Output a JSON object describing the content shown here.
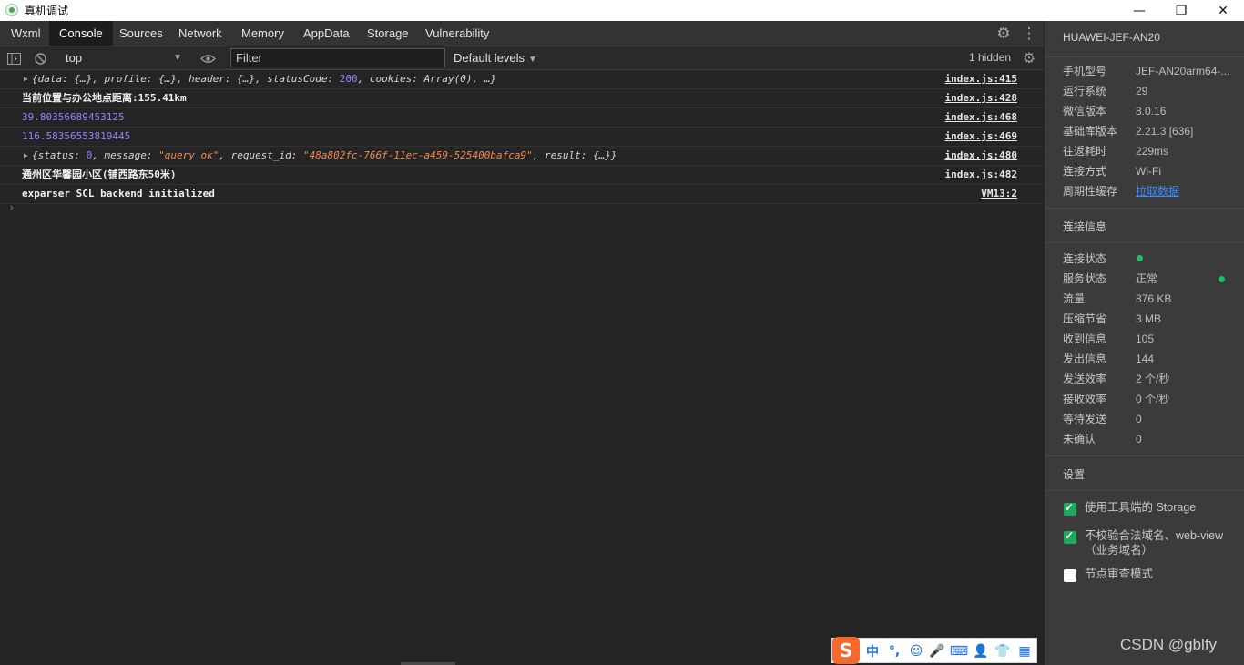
{
  "window": {
    "title": "真机调试",
    "minimize": "—",
    "restore": "❐",
    "close": "✕"
  },
  "tabs": [
    {
      "label": "Wxml"
    },
    {
      "label": "Console"
    },
    {
      "label": "Sources"
    },
    {
      "label": "Network"
    },
    {
      "label": "Memory"
    },
    {
      "label": "AppData"
    },
    {
      "label": "Storage"
    },
    {
      "label": "Vulnerability"
    }
  ],
  "active_tab": "Console",
  "toolbar": {
    "context": "top",
    "filter_placeholder": "Filter",
    "levels": "Default levels",
    "hidden": "1 hidden"
  },
  "console": {
    "rows": [
      {
        "parts": [
          "{data: {…}, profile: {…}, header: {…}, statusCode: ",
          "200",
          ", cookies: Array(0), …}"
        ],
        "source": "index.js:415"
      },
      {
        "text": "当前位置与办公地点距离:155.41km",
        "source": "index.js:428"
      },
      {
        "text": "39.80356689453125",
        "source": "index.js:468"
      },
      {
        "text": "116.58356553819445",
        "source": "index.js:469"
      },
      {
        "parts": [
          "{status: ",
          "0",
          ", message: ",
          "\"query ok\"",
          ", request_id: ",
          "\"48a802fc-766f-11ec-a459-525400bafca9\"",
          ", result: {…}}"
        ],
        "source": "index.js:480"
      },
      {
        "text": "通州区华馨园小区(铺西路东50米)",
        "source": "index.js:482"
      },
      {
        "text": "exparser SCL backend initialized",
        "source": "VM13:2"
      }
    ],
    "prompt": "›"
  },
  "panel": {
    "device": "HUAWEI-JEF-AN20",
    "info": [
      {
        "key": "手机型号",
        "value": "JEF-AN20arm64-..."
      },
      {
        "key": "运行系统",
        "value": "29"
      },
      {
        "key": "微信版本",
        "value": "8.0.16"
      },
      {
        "key": "基础库版本",
        "value": "2.21.3 [636]"
      },
      {
        "key": "往返耗时",
        "value": "229ms"
      },
      {
        "key": "连接方式",
        "value": "Wi-Fi"
      },
      {
        "key": "周期性缓存",
        "value": "拉取数据"
      }
    ],
    "connection_title": "连接信息",
    "connection": [
      {
        "key": "连接状态",
        "value": ""
      },
      {
        "key": "服务状态",
        "value": "正常"
      },
      {
        "key": "流量",
        "value": "876 KB"
      },
      {
        "key": "压缩节省",
        "value": "3 MB"
      },
      {
        "key": "收到信息",
        "value": "105"
      },
      {
        "key": "发出信息",
        "value": "144"
      },
      {
        "key": "发送效率",
        "value": "2 个/秒"
      },
      {
        "key": "接收效率",
        "value": "0 个/秒"
      },
      {
        "key": "等待发送",
        "value": "0"
      },
      {
        "key": "未确认",
        "value": "0"
      }
    ],
    "status_color": "#1fbf5f",
    "settings_title": "设置",
    "settings": [
      {
        "label": "使用工具端的 Storage",
        "checked": true
      },
      {
        "label": "不校验合法域名、web-view（业务域名）",
        "checked": true
      },
      {
        "label": "节点审查模式",
        "checked": false
      }
    ]
  },
  "ime": {
    "logo": "S",
    "items": [
      "中",
      "°,",
      "☺",
      "🎤",
      "⌨",
      "👤",
      "👕",
      "▦"
    ]
  },
  "watermark": "CSDN @gblfy"
}
